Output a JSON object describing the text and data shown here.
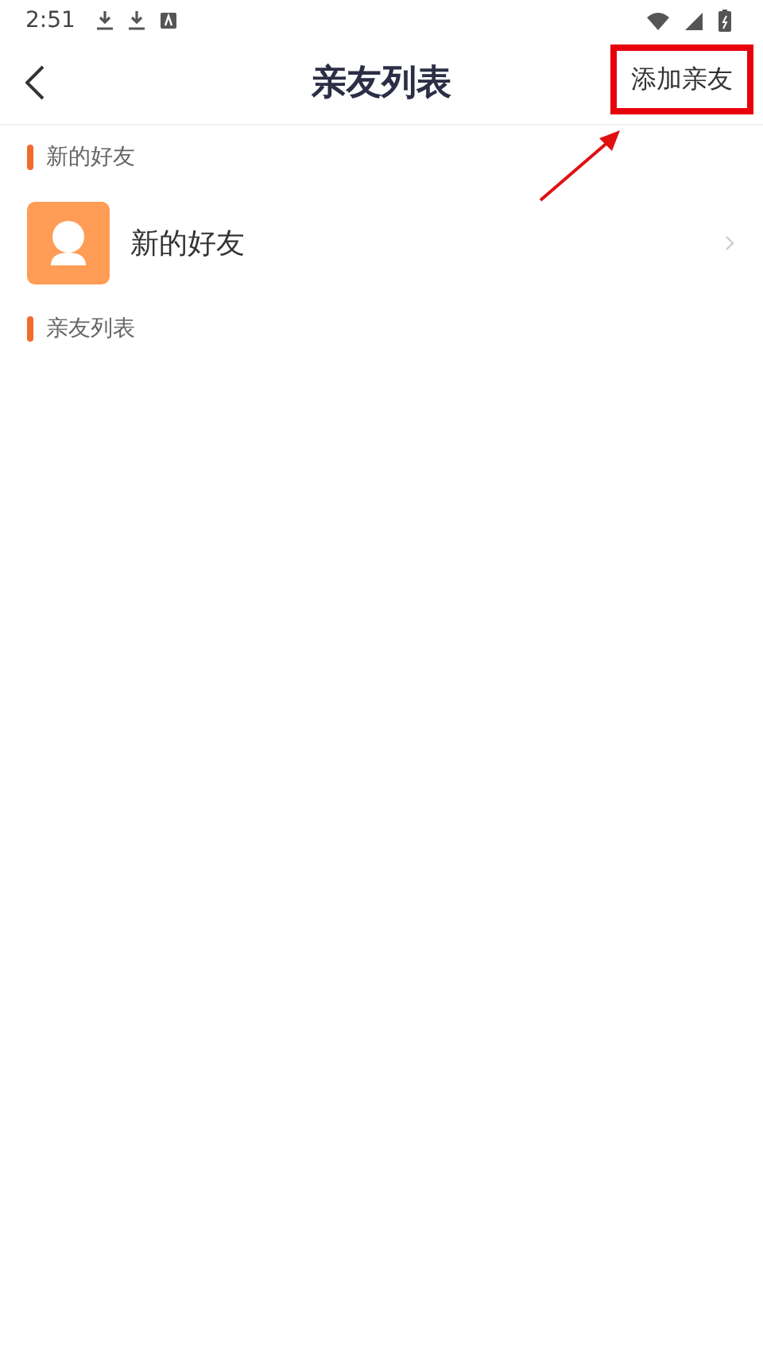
{
  "status_bar": {
    "time": "2:51"
  },
  "header": {
    "title": "亲友列表",
    "action": {
      "label": "添加亲友",
      "highlighted": true
    }
  },
  "sections": [
    {
      "title": "新的好友",
      "items": [
        {
          "label": "新的好友"
        }
      ]
    },
    {
      "title": "亲友列表"
    }
  ]
}
